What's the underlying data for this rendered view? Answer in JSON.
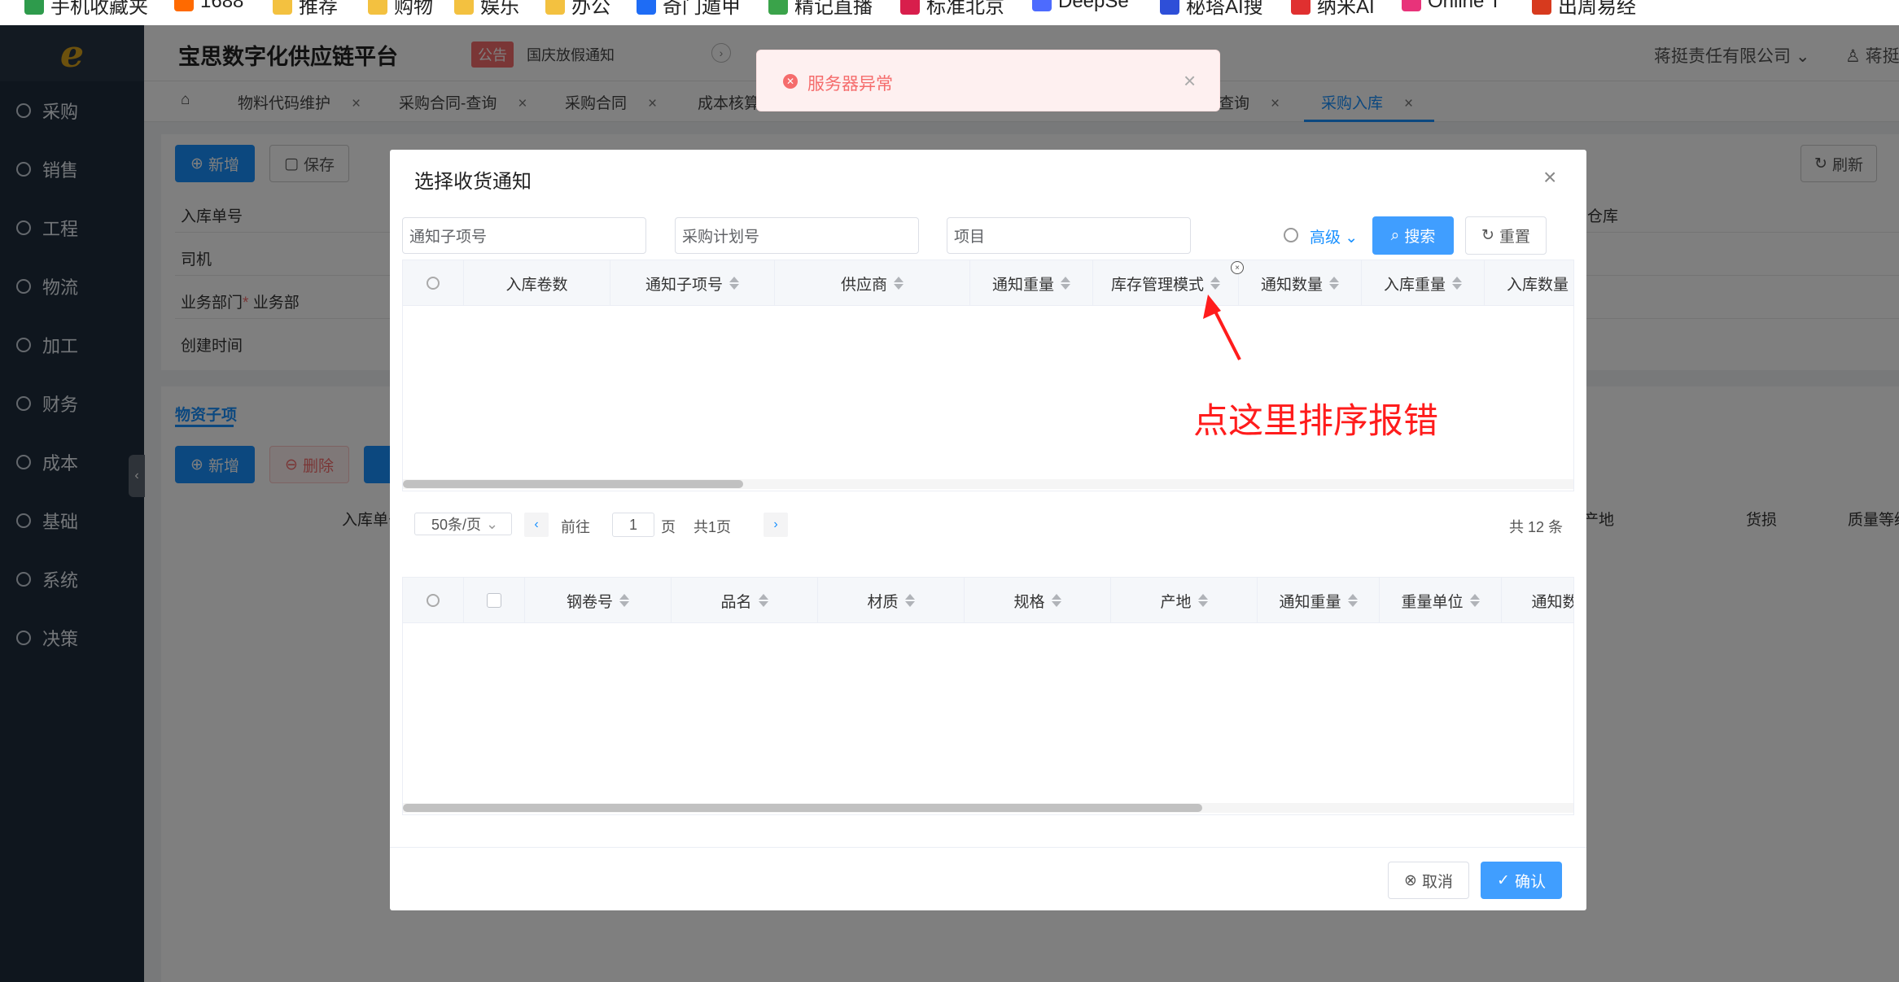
{
  "bookmarks": [
    {
      "label": "手机收藏夹",
      "color": "#2e9b4c"
    },
    {
      "label": "1688",
      "color": "#ff6a00"
    },
    {
      "label": "推荐",
      "color": "#f3c140"
    },
    {
      "label": "购物",
      "color": "#f3c140"
    },
    {
      "label": "娱乐",
      "color": "#f3c140"
    },
    {
      "label": "办公",
      "color": "#f3c140"
    },
    {
      "label": "奇门遁甲",
      "color": "#1e6cf5"
    },
    {
      "label": "精记直播",
      "color": "#3aa34a"
    },
    {
      "label": "标准北京",
      "color": "#d81e4c"
    },
    {
      "label": "DeepSe",
      "color": "#4d6bfe"
    },
    {
      "label": "秘塔AI搜",
      "color": "#2e4fd8"
    },
    {
      "label": "纳米AI",
      "color": "#e03030"
    },
    {
      "label": "Online T",
      "color": "#e8337a"
    },
    {
      "label": "出周易经",
      "color": "#d73a1e"
    }
  ],
  "sidebar": {
    "logo_text": "e",
    "items": [
      {
        "label": "采购",
        "icon": "purchase-icon"
      },
      {
        "label": "销售",
        "icon": "sales-chart-icon"
      },
      {
        "label": "工程",
        "icon": "compass-icon"
      },
      {
        "label": "物流",
        "icon": "home-icon"
      },
      {
        "label": "加工",
        "icon": "process-icon"
      },
      {
        "label": "财务",
        "icon": "yen-icon"
      },
      {
        "label": "成本",
        "icon": "cost-icon"
      },
      {
        "label": "基础",
        "icon": "smile-icon"
      },
      {
        "label": "系统",
        "icon": "gear-icon"
      },
      {
        "label": "决策",
        "icon": "decision-chart-icon"
      }
    ]
  },
  "header": {
    "title": "宝思数字化供应链平台",
    "notice_badge": "公告",
    "notice_text": "国庆放假通知",
    "company": "蒋挺责任有限公司",
    "user": "蒋挺"
  },
  "tabs": [
    {
      "label": "物料代码维护",
      "active": false
    },
    {
      "label": "采购合同-查询",
      "active": false
    },
    {
      "label": "采购合同",
      "active": false
    },
    {
      "label": "成本核算",
      "active": false
    },
    {
      "label": "查询",
      "active": false
    },
    {
      "label": "采购入库",
      "active": true
    }
  ],
  "background_page": {
    "add_label": "新增",
    "save_label": "保存",
    "refresh_label": "刷新",
    "field_labels": [
      "入库单号",
      "司机",
      "业务部门",
      "创建时间"
    ],
    "dept_value": "业务部",
    "warehouse_partial": "仓库",
    "sub_tab": "物资子项",
    "delete_label": "删除",
    "table_headers_partial": [
      "入库单号",
      "产地",
      "货损",
      "质量等级"
    ]
  },
  "toast": {
    "message": "服务器异常"
  },
  "dialog": {
    "title": "选择收货通知",
    "filters": {
      "notice_item_placeholder": "通知子项号",
      "plan_no_placeholder": "采购计划号",
      "project_placeholder": "项目"
    },
    "advanced_label": "高级",
    "search_label": "搜索",
    "reset_label": "重置",
    "upper_table": {
      "columns": [
        "入库卷数",
        "通知子项号",
        "供应商",
        "通知重量",
        "库存管理模式",
        "通知数量",
        "入库重量",
        "入库数量"
      ],
      "rows": []
    },
    "pager": {
      "page_size": "50条/页",
      "goto_prefix": "前往",
      "current_page": "1",
      "page_suffix": "页",
      "total_pages": "共1页",
      "total_records": "共 12 条"
    },
    "lower_table": {
      "columns": [
        "钢卷号",
        "品名",
        "材质",
        "规格",
        "产地",
        "通知重量",
        "重量单位",
        "通知数量"
      ],
      "rows": []
    },
    "cancel_label": "取消",
    "confirm_label": "确认"
  },
  "annotation": {
    "text": "点这里排序报错",
    "color": "#ff1c1c"
  }
}
